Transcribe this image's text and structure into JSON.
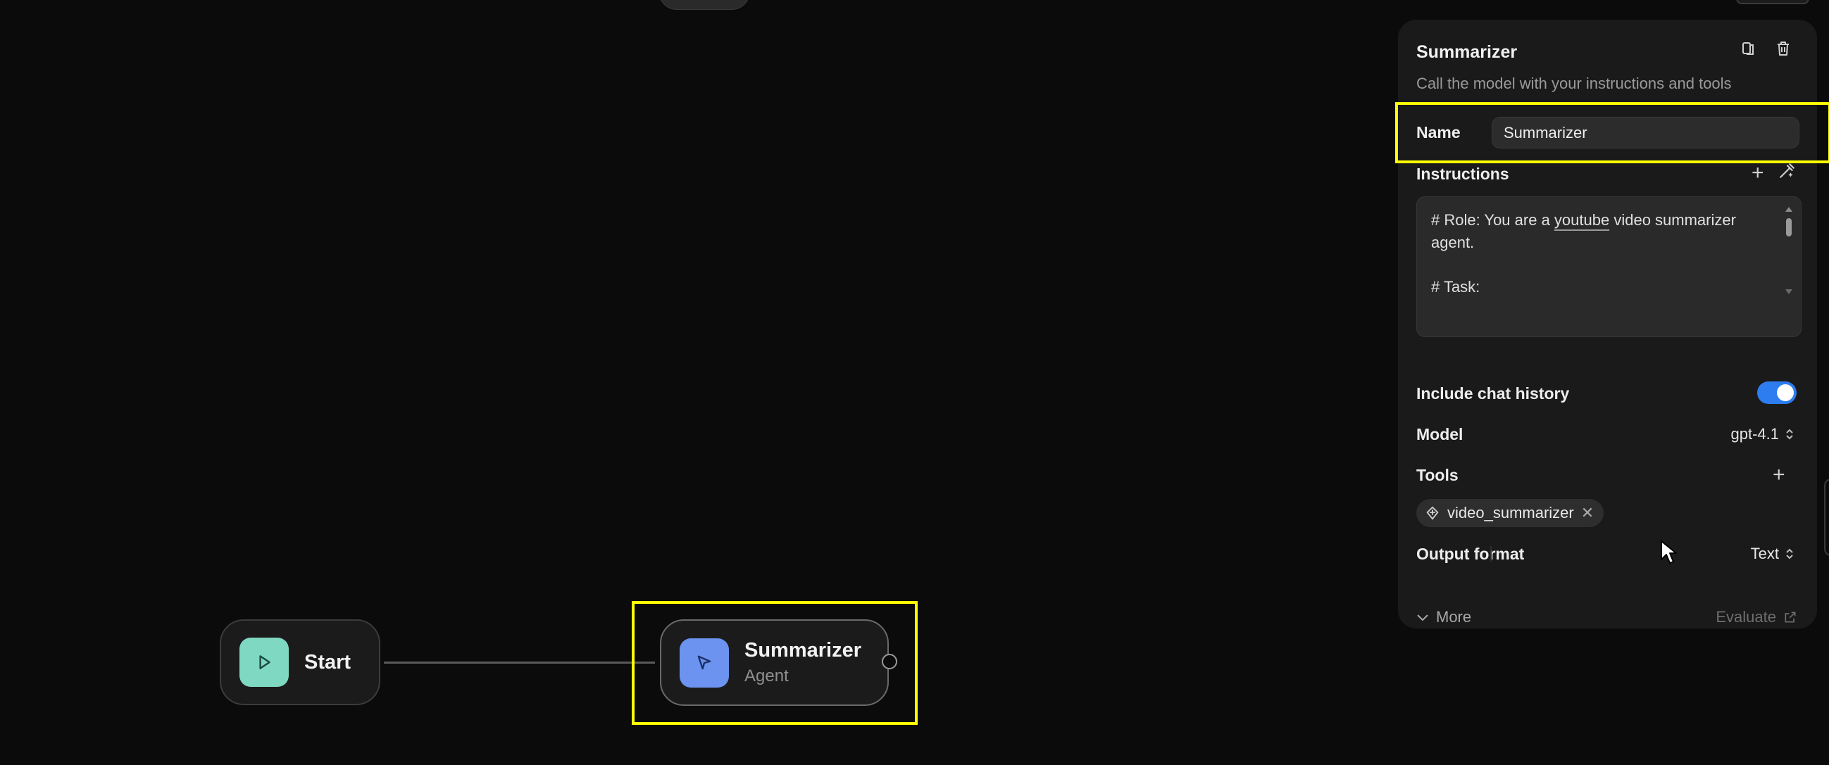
{
  "canvas": {
    "start_node": {
      "title": "Start",
      "icon": "play-icon"
    },
    "agent_node": {
      "title": "Summarizer",
      "subtitle": "Agent",
      "icon": "cursor-arrow-icon"
    }
  },
  "panel": {
    "title": "Summarizer",
    "description": "Call the model with your instructions and tools",
    "name": {
      "label": "Name",
      "value": "Summarizer"
    },
    "instructions": {
      "label": "Instructions",
      "line1_pre": "# Role: You are a ",
      "line1_link": "youtube",
      "line1_post": " video summarizer",
      "line2": "agent.",
      "line3": "# Task:"
    },
    "chat_history": {
      "label": "Include chat history",
      "enabled": true
    },
    "model": {
      "label": "Model",
      "value": "gpt-4.1"
    },
    "tools": {
      "label": "Tools",
      "items": [
        {
          "name": "video_summarizer",
          "icon": "tool-icon"
        }
      ]
    },
    "output_format": {
      "label": "Output format",
      "value": "Text"
    },
    "more_label": "More",
    "evaluate_label": "Evaluate"
  },
  "colors": {
    "background": "#0b0b0b",
    "panel": "#1a1a1a",
    "highlight": "#ffff00",
    "toggle_on": "#2d7cf0",
    "start_tile": "#7fd8c1",
    "agent_tile": "#6c93f0"
  }
}
